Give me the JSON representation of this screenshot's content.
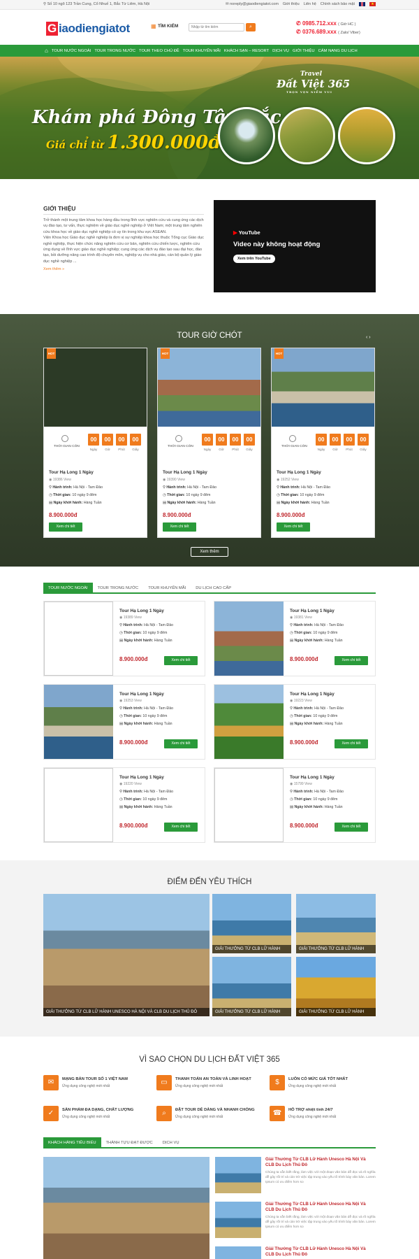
{
  "topbar": {
    "address": "Số 10 ngõ 123 Trần Cung, Cổ Nhuế 1, Bắc Từ Liêm, Hà Nội",
    "email": "noreply@giaodiengiatot.com",
    "links": [
      "Giới thiệu",
      "Liên hệ",
      "Chính sách bảo mật"
    ]
  },
  "header": {
    "logo_g": "G",
    "logo_rest": "iaodiengiatot",
    "search_label": "TÌM KIẾM",
    "search_placeholder": "Nhập từ tìm kiếm",
    "phone1": "0985.712.xxx",
    "phone1_note": "( Giờ HC )",
    "phone2": "0376.689.xxx",
    "phone2_note": "( Zalo/ Viber)"
  },
  "nav": [
    "TOUR NƯỚC NGOÀI",
    "TOUR TRONG NƯỚC",
    "TOUR THEO CHỦ ĐỀ",
    "TOUR KHUYẾN MÃI",
    "KHÁCH SẠN – RESORT",
    "DỊCH VỤ",
    "GIỚI THIỆU",
    "CẨM NANG DU LỊCH"
  ],
  "hero": {
    "headline": "Khám phá Đông Tây Bắc",
    "price_prefix": "Giá chỉ từ",
    "price": "1.300.000đ",
    "brand_top": "Travel",
    "brand_main": "Đất Việt 365",
    "brand_sub": "TRỌN VẸN NIỀM VUI"
  },
  "intro": {
    "title": "GIỚI THIỆU",
    "p1": "Trở thành một trung tâm khoa học hàng đầu trong lĩnh vực nghiên cứu và cung ứng các dịch vụ đào tạo, tư vấn, thực nghiệm về giáo dục nghề nghiệp ở Việt Nam; một trung tâm nghiên cứu khoa học về giáo dục nghề nghiệp có uy tín trong khu vực ASEAN.",
    "p2": "Viện Khoa học Giáo dục nghề nghiệp là đơn vị sự nghiệp khoa học thuộc Tổng cục Giáo dục nghề nghiệp, thực hiện chức năng nghiên cứu cơ bản, nghiên cứu chiến lược, nghiên cứu ứng dụng về lĩnh vực giáo dục nghề nghiệp; cung ứng các dịch vụ đào tạo sau đại học, đào tạo, bồi dưỡng nâng cao trình độ chuyên môn, nghiệp vụ cho nhà giáo, cán bộ quản lý giáo dục nghề nghiệp ...",
    "more": "Xem thêm »",
    "video_logo": "YouTube",
    "video_msg": "Video này không hoạt động",
    "video_btn": "Xem trên YouTube"
  },
  "hot_tours": {
    "title": "TOUR GIỜ CHÓT",
    "badge": "HOT",
    "countdown_label": "THỜI GIAN CÒN",
    "units": [
      "Ngày",
      "Giờ",
      "Phút",
      "Giây"
    ],
    "digit": "00",
    "route_label": "Hành trình:",
    "time_label": "Thời gian:",
    "depart_label": "Ngày khởi hành:",
    "detail_btn": "Xem chi tiết",
    "more_btn": "Xem thêm",
    "cards": [
      {
        "title": "Tour Hạ Long 1 Ngày",
        "views": "19386 View",
        "route": "Hà Nội - Tam Đảo",
        "time": "10 ngày 9 đêm",
        "depart": "Hàng Tuần",
        "price": "8.900.000đ"
      },
      {
        "title": "Tour Hạ Long 1 Ngày",
        "views": "19390 View",
        "route": "Hà Nội - Tam Đảo",
        "time": "10 ngày 9 đêm",
        "depart": "Hàng Tuần",
        "price": "8.900.000đ"
      },
      {
        "title": "Tour Hạ Long 1 Ngày",
        "views": "19252 View",
        "route": "Hà Nội - Tam Đảo",
        "time": "10 ngày 9 đêm",
        "depart": "Hàng Tuần",
        "price": "8.900.000đ"
      }
    ]
  },
  "tour_tabs": {
    "tabs": [
      "TOUR NƯỚC NGOÀI",
      "TOUR TRONG NƯỚC",
      "TOUR KHUYẾN MÃI",
      "DU LỊCH CAO CẤP"
    ],
    "items": [
      {
        "title": "Tour Hạ Long 1 Ngày",
        "views": "19389 View",
        "route": "Hà Nội - Tam Đảo",
        "time": "10 ngày 9 đêm",
        "depart": "Hàng Tuần",
        "price": "8.900.000đ"
      },
      {
        "title": "Tour Hạ Long 1 Ngày",
        "views": "19381 View",
        "route": "Hà Nội - Tam Đảo",
        "time": "10 ngày 9 đêm",
        "depart": "Hàng Tuần",
        "price": "8.900.000đ"
      },
      {
        "title": "Tour Hạ Long 1 Ngày",
        "views": "19253 View",
        "route": "Hà Nội - Tam Đảo",
        "time": "10 ngày 9 đêm",
        "depart": "Hàng Tuần",
        "price": "8.900.000đ"
      },
      {
        "title": "Tour Hạ Long 1 Ngày",
        "views": "19223 View",
        "route": "Hà Nội - Tam Đảo",
        "time": "10 ngày 9 đêm",
        "depart": "Hàng Tuần",
        "price": "8.900.000đ"
      },
      {
        "title": "Tour Hạ Long 1 Ngày",
        "views": "19220 View",
        "route": "Hà Nội - Tam Đảo",
        "time": "10 ngày 9 đêm",
        "depart": "Hàng Tuần",
        "price": "8.900.000đ"
      },
      {
        "title": "Tour Hạ Long 1 Ngày",
        "views": "15799 View",
        "route": "Hà Nội - Tam Đảo",
        "time": "10 ngày 9 đêm",
        "depart": "Hàng Tuần",
        "price": "8.900.000đ"
      }
    ]
  },
  "destinations": {
    "title": "ĐIỂM ĐẾN YÊU THÍCH",
    "big_caption": "GIẢI THƯỞNG TỪ CLB LỮ HÀNH UNESCO HÀ NỘI VÀ CLB DU LỊCH THỦ ĐÔ",
    "small_caption": "GIẢI THƯỞNG TỪ CLB LỮ HÀNH"
  },
  "why": {
    "title": "VÌ SAO CHỌN DU LỊCH ĐẤT VIỆT 365",
    "sub": "Ứng dụng công nghệ mới nhất",
    "items": [
      "MẠNG BÁN TOUR SỐ 1 VIỆT NAM",
      "THANH TOÁN AN TOÀN VÀ LINH HOẠT",
      "LUÔN CÓ MỨC GIÁ TỐT NHẤT",
      "SẢN PHẨM ĐA DẠNG, CHẤT LƯỢNG",
      "ĐẶT TOUR DỄ DÀNG VÀ NHANH CHÓNG",
      "HỖ TRỢ nhiệt tình 24/7"
    ]
  },
  "bottom_tabs": [
    "KHÁCH HÀNG TIÊU BIỂU",
    "THÀNH TỰU ĐẠT ĐƯỢC",
    "DỊCH VỤ"
  ],
  "news": {
    "title": "Giải Thưởng Từ CLB Lữ Hành Unesco Hà Nội Và CLB Du Lịch Thủ Đô",
    "desc": "Chúng ta vẫn biết rằng, làm việc với một đoạn văn bản dễ đọc và rõ nghĩa dễ gây rối trí và cản trở việc tập trung vào yếu tố trình bày văn bản. Lorem Ipsum có ưu điểm hơn so"
  }
}
